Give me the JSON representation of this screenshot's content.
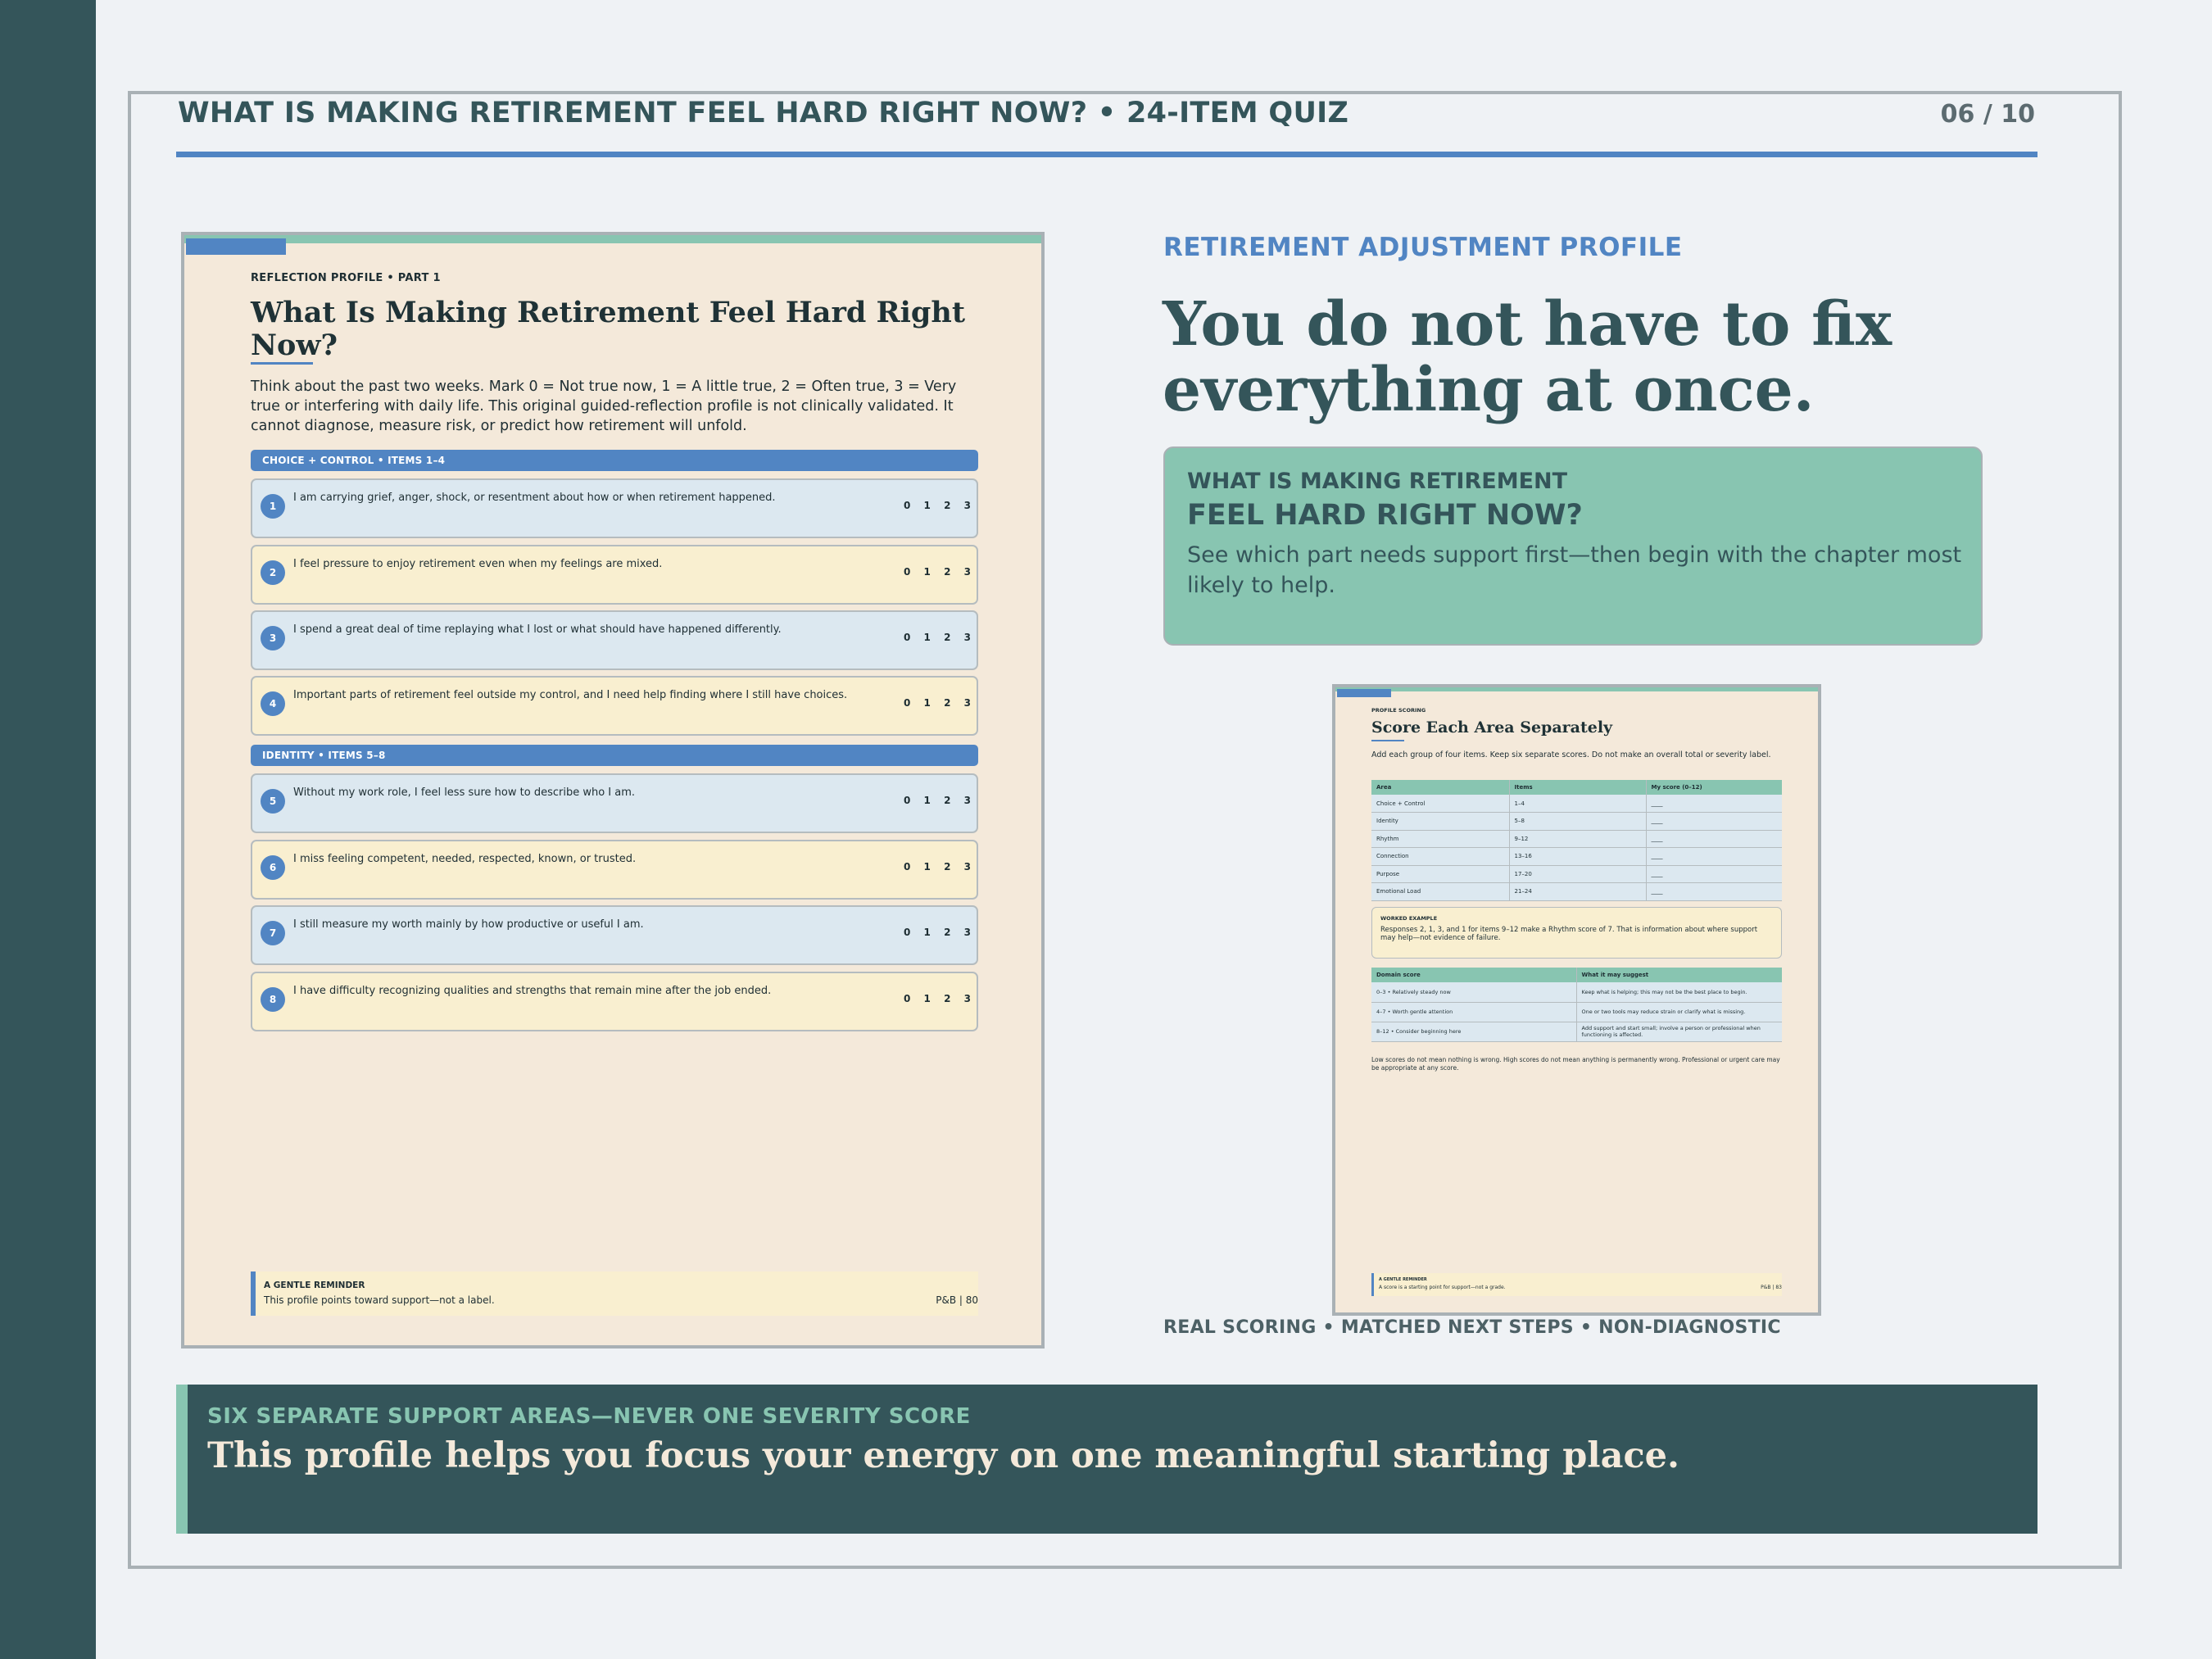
{
  "header": {
    "title": "WHAT IS MAKING RETIREMENT FEEL HARD RIGHT NOW? • 24-ITEM QUIZ",
    "page_counter": "06 / 10"
  },
  "profile_page": {
    "kicker": "REFLECTION PROFILE • PART 1",
    "title": "What Is Making Retirement Feel Hard Right Now?",
    "intro": "Think about the past two weeks. Mark 0 = Not true now, 1 = A little true, 2 = Often true, 3 = Very true or interfering with daily life. This original guided-reflection profile is not clinically validated. It cannot diagnose, measure risk, or predict how retirement will unfold.",
    "scale": [
      "0",
      "1",
      "2",
      "3"
    ],
    "sections": [
      {
        "label": "CHOICE + CONTROL • ITEMS 1–4",
        "items": [
          {
            "num": "1",
            "text": "I am carrying grief, anger, shock, or resentment about how or when retirement happened."
          },
          {
            "num": "2",
            "text": "I feel pressure to enjoy retirement even when my feelings are mixed."
          },
          {
            "num": "3",
            "text": "I spend a great deal of time replaying what I lost or what should have happened differently."
          },
          {
            "num": "4",
            "text": "Important parts of retirement feel outside my control, and I need help finding where I still have choices."
          }
        ]
      },
      {
        "label": "IDENTITY • ITEMS 5–8",
        "items": [
          {
            "num": "5",
            "text": "Without my work role, I feel less sure how to describe who I am."
          },
          {
            "num": "6",
            "text": "I miss feeling competent, needed, respected, known, or trusted."
          },
          {
            "num": "7",
            "text": "I still measure my worth mainly by how productive or useful I am."
          },
          {
            "num": "8",
            "text": "I have difficulty recognizing qualities and strengths that remain mine after the job ended."
          }
        ]
      }
    ],
    "reminder": {
      "kicker": "A GENTLE REMINDER",
      "text": "This profile points toward support—not a label.",
      "page": "P&B  |  80"
    }
  },
  "right": {
    "eyebrow": "RETIREMENT ADJUSTMENT PROFILE",
    "headline": "You do not have to fix everything at once.",
    "callout": {
      "line1": "WHAT IS MAKING RETIREMENT",
      "line2": "FEEL HARD RIGHT NOW?",
      "body": "See which part needs support first—then begin with the chapter most likely to help."
    },
    "caption": "REAL SCORING • MATCHED NEXT STEPS • NON-DIAGNOSTIC"
  },
  "scoring_page": {
    "kicker": "PROFILE SCORING",
    "title": "Score Each Area Separately",
    "intro": "Add each group of four items. Keep six separate scores. Do not make an overall total or severity label.",
    "table": {
      "headers": [
        "Area",
        "Items",
        "My score (0–12)"
      ],
      "rows": [
        [
          "Choice + Control",
          "1–4",
          "____"
        ],
        [
          "Identity",
          "5–8",
          "____"
        ],
        [
          "Rhythm",
          "9–12",
          "____"
        ],
        [
          "Connection",
          "13–16",
          "____"
        ],
        [
          "Purpose",
          "17–20",
          "____"
        ],
        [
          "Emotional Load",
          "21–24",
          "____"
        ]
      ]
    },
    "worked_example": {
      "kicker": "WORKED EXAMPLE",
      "text": "Responses 2, 1, 3, and 1 for items 9–12 make a Rhythm score of 7. That is information about where support may help—not evidence of failure."
    },
    "table2": {
      "headers": [
        "Domain score",
        "What it may suggest"
      ],
      "rows": [
        [
          "0–3 • Relatively steady now",
          "Keep what is helping; this may not be the best place to begin."
        ],
        [
          "4–7 • Worth gentle attention",
          "One or two tools may reduce strain or clarify what is missing."
        ],
        [
          "8–12 • Consider beginning here",
          "Add support and start small; involve a person or professional when functioning is affected."
        ]
      ]
    },
    "footnote": "Low scores do not mean nothing is wrong. High scores do not mean anything is permanently wrong. Professional or urgent care may be appropriate at any score.",
    "reminder": {
      "kicker": "A GENTLE REMINDER",
      "text": "A score is a starting point for support—not a grade.",
      "page": "P&B  |  83"
    }
  },
  "banner": {
    "kicker": "SIX SEPARATE SUPPORT AREAS—NEVER ONE SEVERITY SCORE",
    "text": "This profile helps you focus your energy on one meaningful starting place."
  }
}
